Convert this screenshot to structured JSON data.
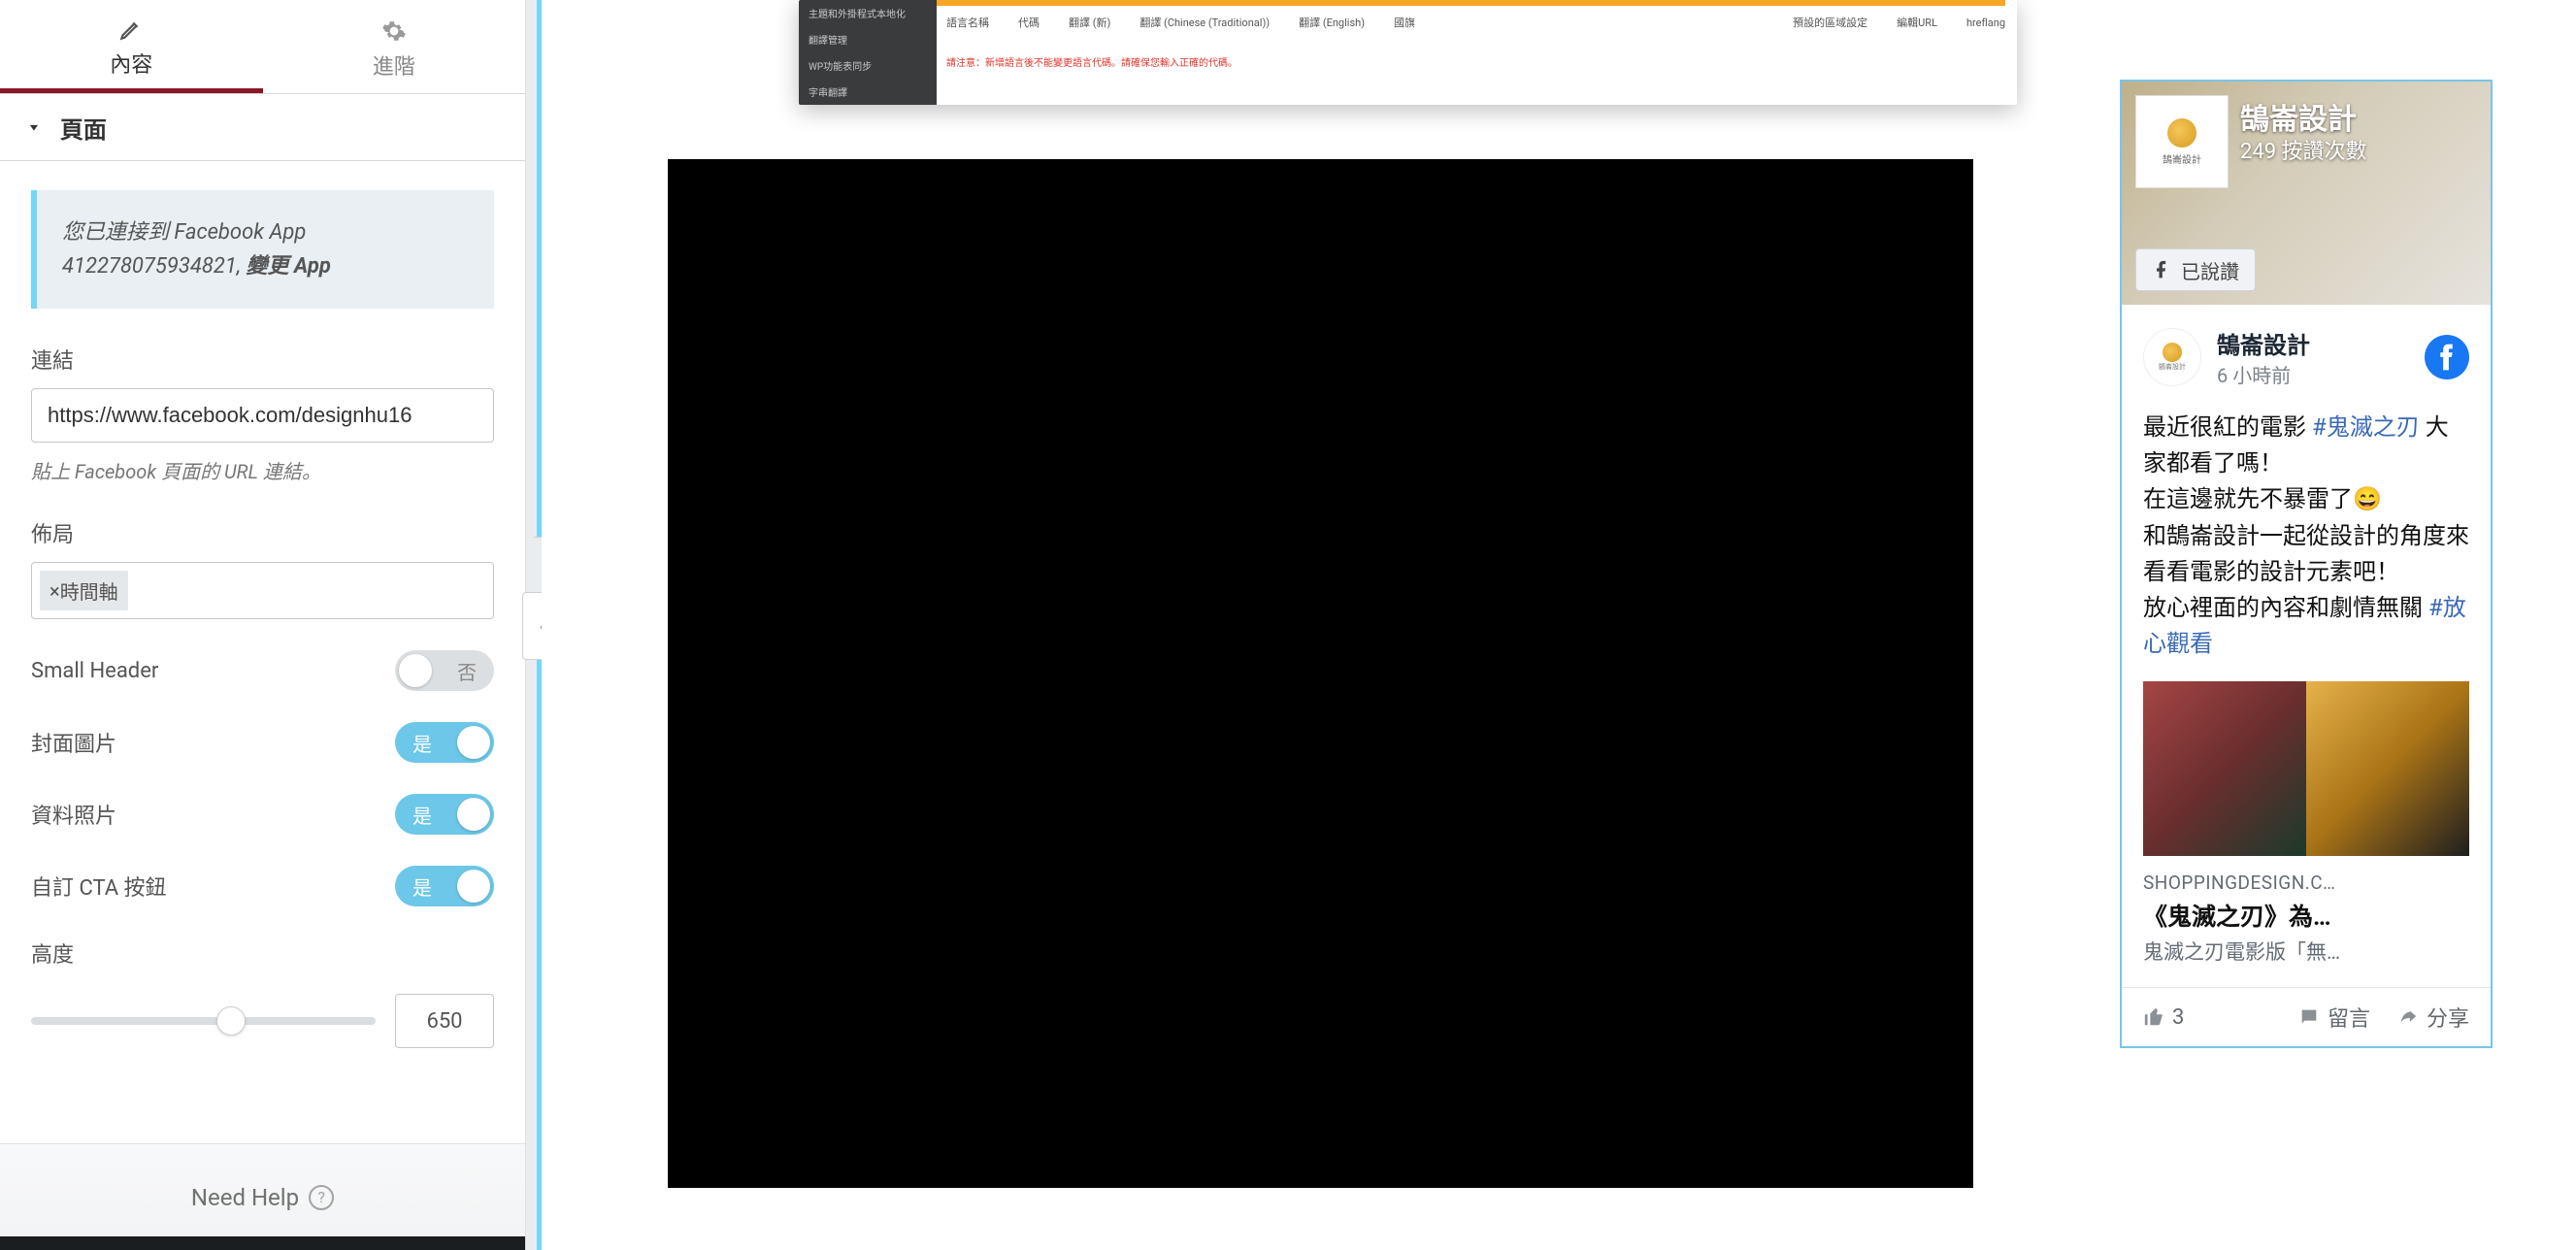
{
  "tabs": {
    "content": "內容",
    "advanced": "進階"
  },
  "accordion": {
    "page": "頁面"
  },
  "info": {
    "prefix": "您已連接到 Facebook App 412278075934821, ",
    "change_app": "變更 App"
  },
  "link": {
    "label": "連結",
    "value": "https://www.facebook.com/designhu16",
    "helper": "貼上 Facebook 頁面的 URL 連結。"
  },
  "layout": {
    "label": "佈局",
    "tag_prefix": "×",
    "tag_text": "時間軸"
  },
  "toggles": {
    "small_header": {
      "label": "Small Header",
      "text": "否"
    },
    "cover": {
      "label": "封面圖片",
      "text": "是"
    },
    "profile": {
      "label": "資料照片",
      "text": "是"
    },
    "cta": {
      "label": "自訂 CTA 按鈕",
      "text": "是"
    }
  },
  "height": {
    "label": "高度",
    "value": "650"
  },
  "footer": {
    "need_help": "Need Help"
  },
  "mini": {
    "side1": "主題和外掛程式本地化",
    "side2": "翻譯管理",
    "side3": "WP功能表同步",
    "side4": "字串翻譯",
    "h1": "語言名稱",
    "h2": "代碼",
    "h3": "翻譯 (新)",
    "h4": "翻譯 (Chinese (Traditional))",
    "h5": "翻譯 (English)",
    "h6": "國旗",
    "h7": "預設的區域設定",
    "h8": "編輯URL",
    "h9": "hreflang",
    "note": "請注意：新增語言後不能變更語言代碼。請確保您輸入正確的代碼。"
  },
  "fb": {
    "page_name": "鵠崙設計",
    "likes_text": "249 按讚次數",
    "liked_label": "已說讚",
    "logo_txt": "鵠崙設計",
    "post": {
      "author": "鵠崙設計",
      "time": "6 小時前",
      "l1a": "最近很紅的電影 ",
      "hash1": "#鬼滅之刃",
      "l1c": " 大家都看了嗎！",
      "l2": "在這邊就先不暴雷了",
      "l3": "和鵠崙設計一起從設計的角度來看看電影的設計元素吧！",
      "l4a": "放心裡面的內容和劇情無關 ",
      "hash2": "#放心觀看",
      "card_domain": "SHOPPINGDESIGN.C…",
      "card_title": "《鬼滅之刃》為…",
      "card_sub": "鬼滅之刃電影版「無…"
    },
    "actions": {
      "likes": "3",
      "comment": "留言",
      "share": "分享"
    }
  }
}
